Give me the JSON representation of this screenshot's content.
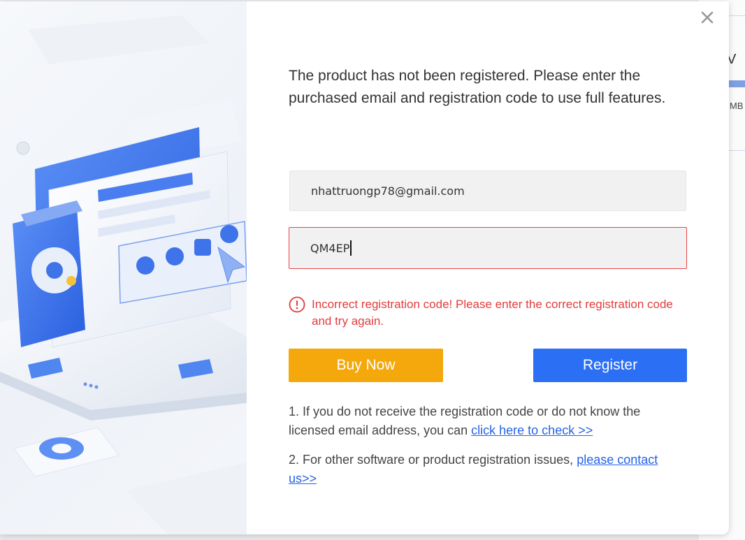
{
  "background_app": {
    "visible_letter": "V",
    "size_text": "MB"
  },
  "dialog": {
    "message": "The product has not been registered. Please enter the purchased email and registration code to use full features.",
    "email_value": "nhattruongp78@gmail.com",
    "code_value": "QM4EP",
    "error_text": "Incorrect registration code! Please enter the correct registration code and try again.",
    "buy_label": "Buy Now",
    "register_label": "Register",
    "note1_text": "1. If you do not receive the registration code or do not know the licensed email address, you can ",
    "note1_link": "click here to check >>",
    "note2_text": "2. For other software or product registration issues, ",
    "note2_link": "please contact us>>",
    "close_icon": "close-icon"
  },
  "colors": {
    "buy": "#f5a80c",
    "register": "#2b6ff5",
    "error": "#e23c3c",
    "link": "#2563e8"
  }
}
